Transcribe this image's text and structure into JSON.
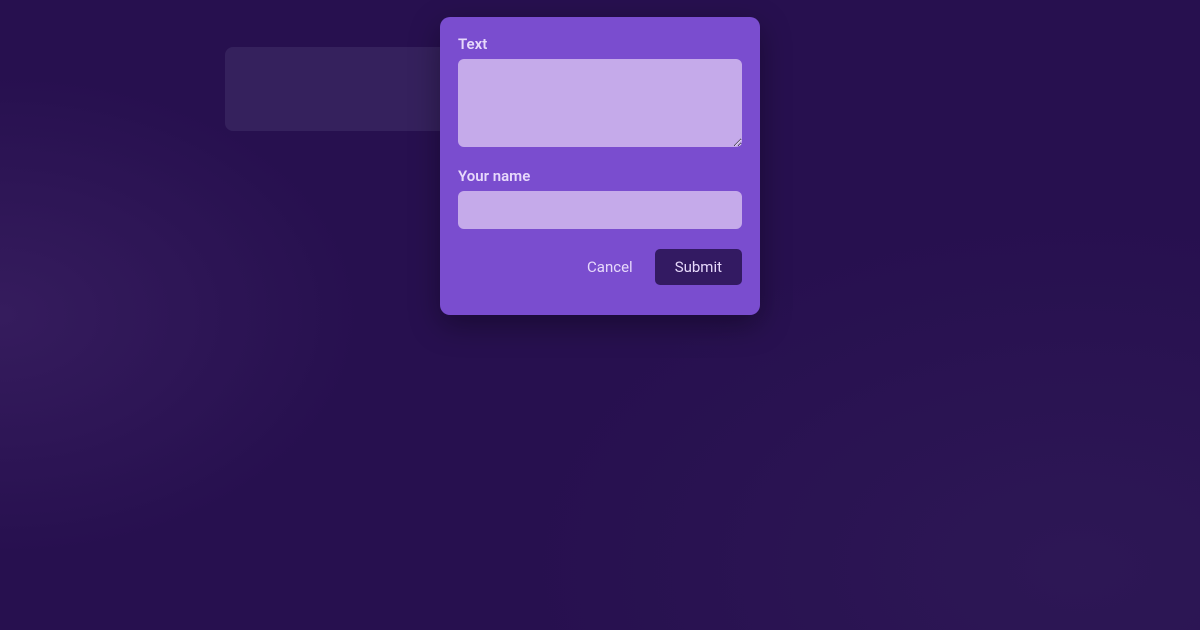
{
  "form": {
    "text": {
      "label": "Text",
      "value": ""
    },
    "name": {
      "label": "Your name",
      "value": ""
    },
    "buttons": {
      "cancel": "Cancel",
      "submit": "Submit"
    }
  }
}
